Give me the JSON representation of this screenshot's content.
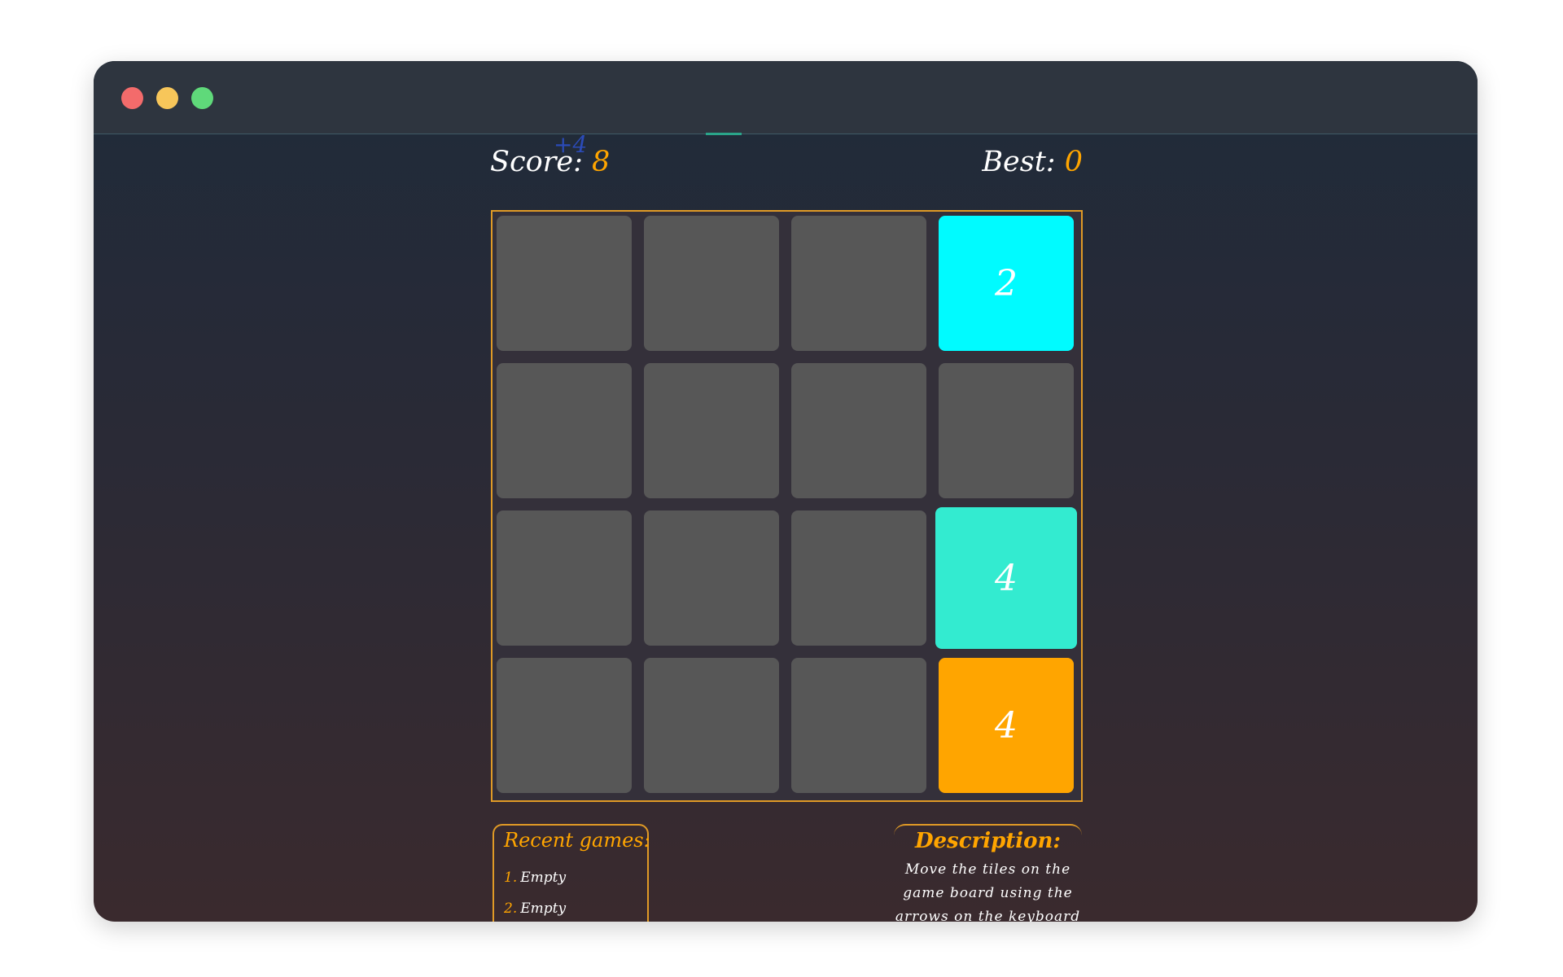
{
  "window": {
    "controls": [
      "close-icon",
      "minimize-icon",
      "maximize-icon"
    ]
  },
  "score": {
    "label": "Score:",
    "value": "8",
    "delta": "+4"
  },
  "best": {
    "label": "Best:",
    "value": "0"
  },
  "board": {
    "size": 4,
    "tiles": [
      {
        "row": 0,
        "col": 3,
        "value": "2",
        "color": "#00fbff"
      },
      {
        "row": 2,
        "col": 3,
        "value": "4",
        "color": "#33ebd0"
      },
      {
        "row": 3,
        "col": 3,
        "value": "4",
        "color": "#ffa500"
      }
    ],
    "border_color": "#e09a26",
    "empty_color": "#575757"
  },
  "recent_games": {
    "title": "Recent games:",
    "items": [
      {
        "num": "1.",
        "label": "Empty"
      },
      {
        "num": "2.",
        "label": "Empty"
      }
    ]
  },
  "description": {
    "title": "Description:",
    "text": "Move the tiles on the game board using the arrows on the keyboard or"
  },
  "colors": {
    "accent": "#ffa500",
    "delta": "#2b4bb8"
  }
}
